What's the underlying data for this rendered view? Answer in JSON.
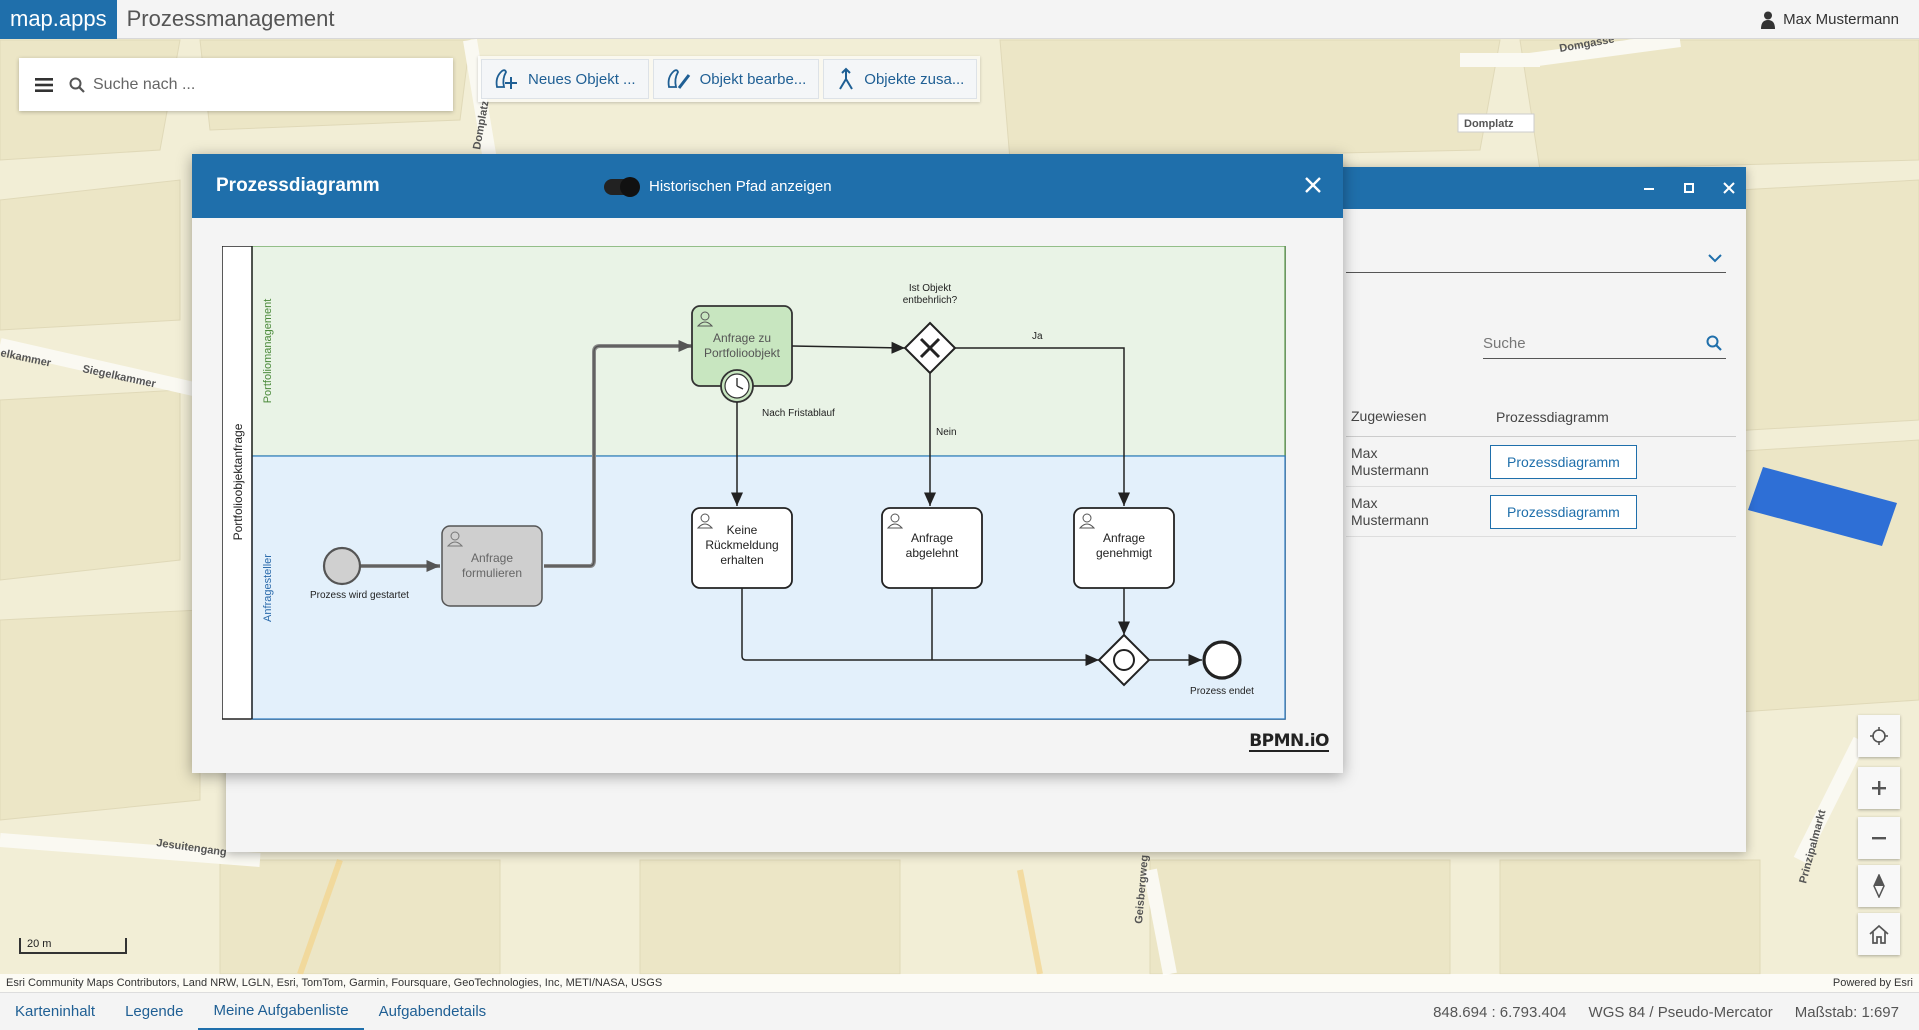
{
  "app": {
    "brand": "map.apps",
    "title": "Prozessmanagement"
  },
  "user": {
    "name": "Max Mustermann"
  },
  "search": {
    "placeholder": "Suche nach ..."
  },
  "toolbar": {
    "new_object": "Neues Objekt ...",
    "edit_object": "Objekt bearbe...",
    "merge_objects": "Objekte zusa..."
  },
  "map_labels": {
    "domgasse": "Domgasse",
    "domplatz_road": "Domplatz",
    "domplatz_label": "Domplatz",
    "kammer": "elkammer",
    "siegelkammer": "Siegelkammer",
    "jesuitengang": "Jesuitengang",
    "geisbergweg": "Geisbergweg",
    "prinzipalmarkt": "Prinzipalmarkt"
  },
  "back_window": {
    "search_placeholder": "Suche",
    "columns": [
      "Zugewiesen",
      "Prozessdiagramm"
    ],
    "rows": [
      {
        "assignee_first": "Max",
        "assignee_last": "Mustermann",
        "button": "Prozessdiagramm"
      },
      {
        "assignee_first": "Max",
        "assignee_last": "Mustermann",
        "button": "Prozessdiagramm"
      }
    ]
  },
  "dialog": {
    "title": "Prozessdiagramm",
    "toggle_label": "Historischen Pfad anzeigen",
    "toggle_on": true
  },
  "diagram": {
    "pool": "Portfolioobjektanfrage",
    "lane_top": "Portfoliomanagement",
    "lane_bottom": "Anfragesteller",
    "start_event": "Prozess wird gestartet",
    "task_formulate": [
      "Anfrage",
      "formulieren"
    ],
    "task_review": [
      "Anfrage zu",
      "Portfolioobjekt"
    ],
    "timer_label": "Nach Fristablauf",
    "gateway_label": [
      "Ist Objekt",
      "entbehrlich?"
    ],
    "yes": "Ja",
    "no": "Nein",
    "task_no_reply": [
      "Keine",
      "Rückmeldung",
      "erhalten"
    ],
    "task_rejected": [
      "Anfrage",
      "abgelehnt"
    ],
    "task_approved": [
      "Anfrage",
      "genehmigt"
    ],
    "end_event": "Prozess endet",
    "logo": "BPMN.iO"
  },
  "scale": {
    "label": "20 m"
  },
  "attribution": {
    "text": "Esri Community Maps Contributors, Land NRW, LGLN, Esri, TomTom, Garmin, Foursquare, GeoTechnologies, Inc, METI/NASA, USGS",
    "powered": "Powered by Esri"
  },
  "bottom_tabs": [
    "Karteninhalt",
    "Legende",
    "Meine Aufgabenliste",
    "Aufgabendetails"
  ],
  "active_tab": "Meine Aufgabenliste",
  "status": {
    "coords": "848.694 : 6.793.404",
    "crs": "WGS 84 / Pseudo-Mercator",
    "scale": "Maßstab: 1:697"
  },
  "colors": {
    "brand": "#1f6fab",
    "lane_top_bg": "#e9f3e6",
    "lane_bottom_bg": "#e3f0fb",
    "task_active": "#c8e6c0",
    "task_done": "#cfcfcf",
    "map_selection": "#2e6fd6"
  }
}
